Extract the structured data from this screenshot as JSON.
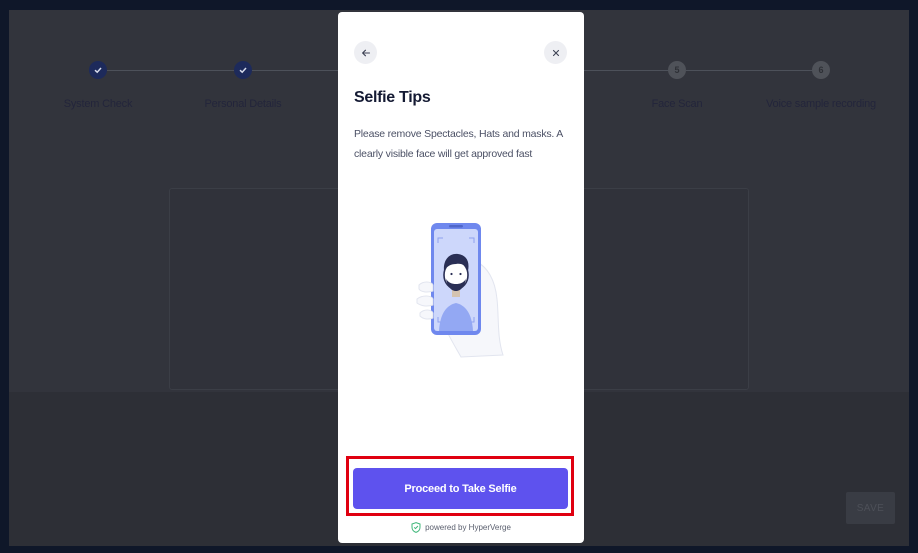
{
  "steps": [
    {
      "label": "System Check",
      "status": "done",
      "badge": ""
    },
    {
      "label": "Personal Details",
      "status": "done",
      "badge": ""
    },
    {
      "label": "Face Scan",
      "status": "pending",
      "badge": "5"
    },
    {
      "label": "Voice sample recording",
      "status": "pending",
      "badge": "6"
    }
  ],
  "background": {
    "save_label": "SAVE"
  },
  "modal": {
    "title": "Selfie Tips",
    "description": "Please remove Spectacles, Hats and masks. A clearly visible face will get approved fast",
    "proceed_label": "Proceed to Take Selfie",
    "powered_by": "powered by HyperVerge"
  },
  "colors": {
    "accent": "#5e52ee",
    "highlight_border": "#e00010",
    "overlay": "#32343c"
  },
  "icons": {
    "back": "arrow-left-icon",
    "close": "close-icon",
    "step_done": "check-icon",
    "illustration": "selfie-phone-illustration",
    "powered": "shield-check-icon"
  }
}
